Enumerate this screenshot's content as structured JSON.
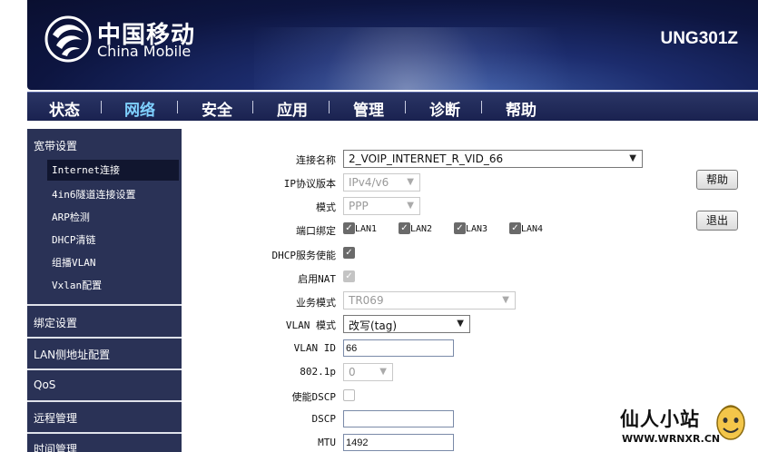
{
  "header": {
    "brand_cn": "中国移动",
    "brand_en": "China Mobile",
    "model": "UNG301Z"
  },
  "nav": {
    "items": [
      "状态",
      "网络",
      "安全",
      "应用",
      "管理",
      "诊断",
      "帮助"
    ],
    "active": "网络"
  },
  "sidebar": {
    "groups": {
      "broadband": "宽带设置",
      "binding": "绑定设置",
      "lan_address": "LAN侧地址配置",
      "qos": "QoS",
      "remote": "远程管理",
      "time": "时间管理"
    },
    "sub_items": [
      "Internet连接",
      "4in6隧道连接设置",
      "ARP检测",
      "DHCP清链",
      "组播VLAN",
      "Vxlan配置"
    ],
    "active_sub": "Internet连接"
  },
  "form": {
    "conn_name_label": "连接名称",
    "conn_name_value": "2_VOIP_INTERNET_R_VID_66",
    "ip_version_label": "IP协议版本",
    "ip_version_value": "IPv4/v6",
    "mode_label": "模式",
    "mode_value": "PPP",
    "port_binding_label": "端口绑定",
    "ports": [
      "LAN1",
      "LAN2",
      "LAN3",
      "LAN4"
    ],
    "dhcp_label": "DHCP服务使能",
    "nat_label": "启用NAT",
    "service_mode_label": "业务模式",
    "service_mode_value": "TR069",
    "vlan_mode_label": "VLAN 模式",
    "vlan_mode_value": "改写(tag)",
    "vlan_id_label": "VLAN ID",
    "vlan_id_value": "66",
    "p8021_label": "802.1p",
    "p8021_value": "0",
    "dscp_enable_label": "使能DSCP",
    "dscp_label": "DSCP",
    "dscp_value": "",
    "mtu_label": "MTU",
    "mtu_value": "1492"
  },
  "buttons": {
    "help": "帮助",
    "logout": "退出"
  },
  "watermark": {
    "text": "仙人小站",
    "url": "WWW.WRNXR.CN"
  }
}
